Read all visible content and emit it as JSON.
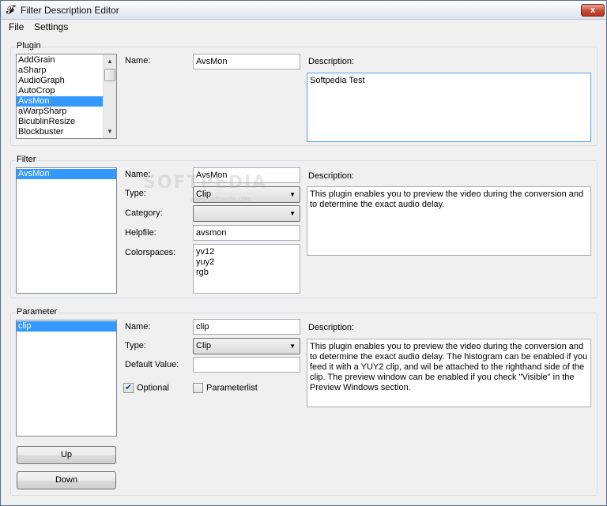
{
  "window": {
    "title": "Filter Description Editor",
    "close_glyph": "x"
  },
  "menu": [
    "File",
    "Settings"
  ],
  "plugin": {
    "group_label": "Plugin",
    "items": [
      "AddGrain",
      "aSharp",
      "AudioGraph",
      "AutoCrop",
      "AvsMon",
      "aWarpSharp",
      "BicublinResize",
      "Blockbuster"
    ],
    "selected_index": 4,
    "name_label": "Name:",
    "name_value": "AvsMon",
    "description_label": "Description:",
    "description_value": "Softpedia Test"
  },
  "filter": {
    "group_label": "Filter",
    "items": [
      "AvsMon"
    ],
    "selected_index": 0,
    "name_label": "Name:",
    "name_value": "AvsMon",
    "type_label": "Type:",
    "type_value": "Clip",
    "category_label": "Category:",
    "category_value": "",
    "helpfile_label": "Helpfile:",
    "helpfile_value": "avsmon",
    "colorspaces_label": "Colorspaces:",
    "colorspaces": [
      "yv12",
      "yuy2",
      "rgb"
    ],
    "description_label": "Description:",
    "description_value": "This plugin enables you to preview the video during the conversion and to determine the exact audio delay."
  },
  "parameter": {
    "group_label": "Parameter",
    "items": [
      "clip"
    ],
    "selected_index": 0,
    "name_label": "Name:",
    "name_value": "clip",
    "type_label": "Type:",
    "type_value": "Clip",
    "default_label": "Default Value:",
    "default_value": "",
    "optional_label": "Optional",
    "optional_checked": true,
    "parameterlist_label": "Parameterlist",
    "parameterlist_checked": false,
    "description_label": "Description:",
    "description_value": "This plugin enables you to preview the video during the conversion and to determine the exact audio delay. The histogram can be enabled if you feed it with a YUY2 clip,  and wil be attached to the righthand side of the clip. The preview window can be enabled if you check \"Visible\" in the Preview Windows section."
  },
  "buttons": {
    "up": "Up",
    "down": "Down"
  },
  "watermark": {
    "main": "SOFTPEDIA",
    "sub": "www.softpedia.com"
  }
}
